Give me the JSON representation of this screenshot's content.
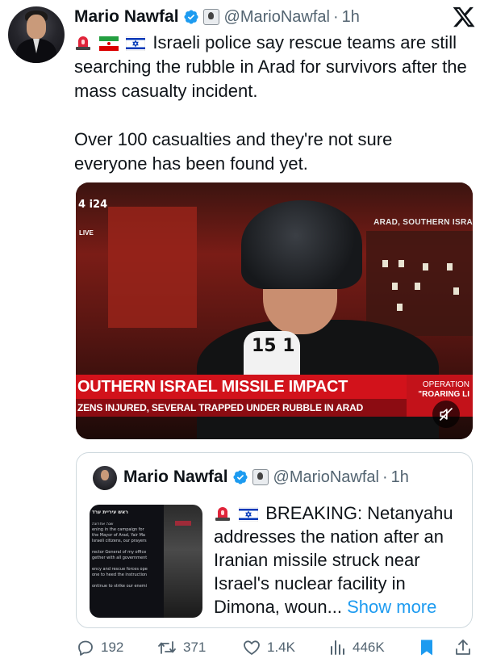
{
  "tweet": {
    "author_name": "Mario Nawfal",
    "handle": "@MarioNawfal",
    "separator": "·",
    "time": "1h",
    "paragraph1": "Israeli police say rescue teams are still searching the rubble in Arad for survivors after the mass casualty incident.",
    "paragraph2": "Over 100 casualties and they're not sure everyone has been found yet."
  },
  "video": {
    "channel_logo": "4 i24",
    "live_label": "LIVE",
    "location": "ARAD, SOUTHERN ISRA",
    "mic_label": "15 1",
    "headline": "OUTHERN ISRAEL MISSILE IMPACT",
    "subheadline": "ZENS INJURED, SEVERAL TRAPPED UNDER RUBBLE IN ARAD",
    "op_line1": "OPERATION",
    "op_line2": "\"ROARING LI"
  },
  "quote": {
    "author_name": "Mario Nawfal",
    "handle": "@MarioNawfal",
    "separator": "·",
    "time": "1h",
    "text": "BREAKING: Netanyahu addresses the nation after an Iranian missile struck near Israel's nuclear facility in Dimona, woun...",
    "show_more": "Show more",
    "doc_header": "ראש עיריית ערד",
    "doc_lines": [
      "שנה אחרונה",
      "ening in the campaign for",
      "the Mayor of Arad, Yair Ma",
      "Israeli citizens, our prayers",
      "",
      "rector General of my office",
      "gether with all government",
      "",
      "ency and rescue forces ope",
      "one to heed the instruction",
      "",
      "ontinue to strike our enemi"
    ]
  },
  "actions": {
    "replies": "192",
    "reposts": "371",
    "likes": "1.4K",
    "views": "446K"
  },
  "colors": {
    "verified": "#1d9bf0",
    "link": "#1d9bf0",
    "muted_text": "#536471",
    "headline_red": "#d2121b"
  }
}
